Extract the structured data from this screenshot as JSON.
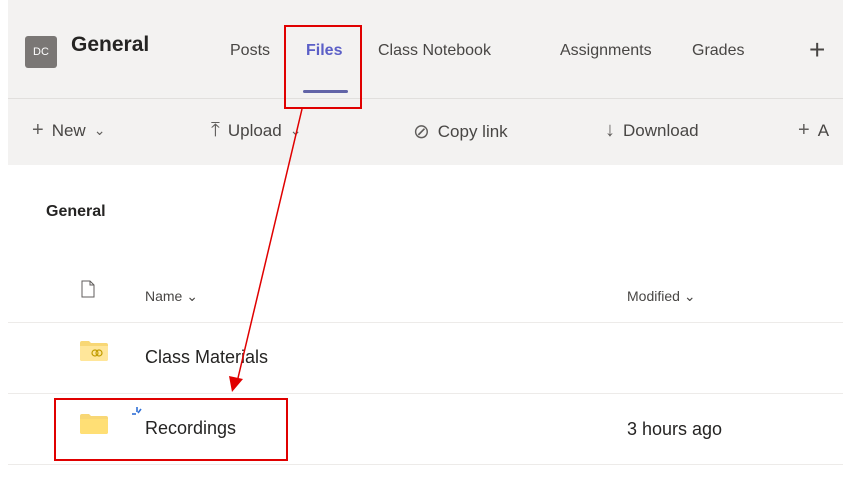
{
  "header": {
    "avatar_initials": "DC",
    "channel_title": "General",
    "tabs": [
      {
        "label": "Posts",
        "active": false
      },
      {
        "label": "Files",
        "active": true
      },
      {
        "label": "Class Notebook",
        "active": false
      },
      {
        "label": "Assignments",
        "active": false
      },
      {
        "label": "Grades",
        "active": false
      }
    ],
    "add_tab_icon": "plus-icon"
  },
  "toolbar": {
    "new_label": "New",
    "upload_label": "Upload",
    "copy_link_label": "Copy link",
    "download_label": "Download",
    "add_label": "A"
  },
  "content": {
    "breadcrumb": "General",
    "columns": {
      "name": "Name",
      "modified": "Modified"
    },
    "rows": [
      {
        "name": "Class Materials",
        "modified": "",
        "icon": "shared-folder-icon"
      },
      {
        "name": "Recordings",
        "modified": "3 hours ago",
        "icon": "folder-icon",
        "new": true
      }
    ]
  },
  "colors": {
    "accent": "#6264a7",
    "highlight": "#e00000",
    "folder": "#f8d775"
  }
}
